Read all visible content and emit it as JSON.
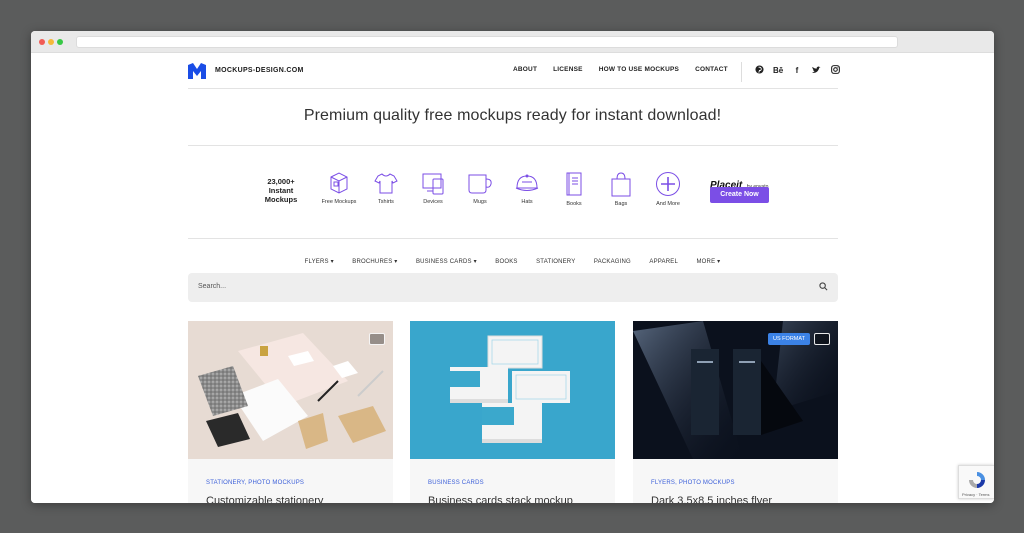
{
  "header": {
    "brand": "MOCKUPS-DESIGN.COM",
    "nav": [
      "ABOUT",
      "LICENSE",
      "HOW TO USE MOCKUPS",
      "CONTACT"
    ],
    "social": [
      "pinterest-icon",
      "behance-icon",
      "facebook-icon",
      "twitter-icon",
      "instagram-icon"
    ],
    "behance_text": "Bē",
    "facebook_text": "f"
  },
  "hero": {
    "title": "Premium quality free mockups ready for instant download!"
  },
  "categories": {
    "count_lines": [
      "23,000+",
      "Instant",
      "Mockups"
    ],
    "items": [
      "Free Mockups",
      "Tshirts",
      "Devices",
      "Mugs",
      "Hats",
      "Books",
      "Bags",
      "And More"
    ],
    "placeit": "Placeit",
    "by": "by envato",
    "cta": "Create Now"
  },
  "subnav": [
    "FLYERS ▾",
    "BROCHURES ▾",
    "BUSINESS CARDS ▾",
    "BOOKS",
    "STATIONERY",
    "PACKAGING",
    "APPAREL",
    "MORE ▾"
  ],
  "search": {
    "placeholder": "Search..."
  },
  "cards": [
    {
      "tags": "STATIONERY, PHOTO MOCKUPS",
      "title": "Customizable stationery",
      "badge": ""
    },
    {
      "tags": "BUSINESS CARDS",
      "title": "Business cards stack mockup",
      "badge": ""
    },
    {
      "tags": "FLYERS, PHOTO MOCKUPS",
      "title": "Dark 3.5x8.5 inches flyer",
      "badge": "US FORMAT"
    }
  ],
  "recaptcha": {
    "text": "Privacy · Terms"
  },
  "colors": {
    "accent": "#7b4ee6",
    "link": "#3b5fd9",
    "brand": "#1a4de6"
  }
}
